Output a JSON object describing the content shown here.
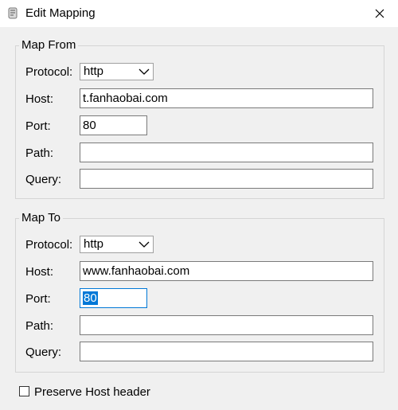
{
  "window": {
    "title": "Edit Mapping",
    "close_label": "×"
  },
  "map_from": {
    "legend": "Map From",
    "protocol_label": "Protocol:",
    "protocol_value": "http",
    "host_label": "Host:",
    "host_value": "t.fanhaobai.com",
    "port_label": "Port:",
    "port_value": "80",
    "path_label": "Path:",
    "path_value": "",
    "query_label": "Query:",
    "query_value": ""
  },
  "map_to": {
    "legend": "Map To",
    "protocol_label": "Protocol:",
    "protocol_value": "http",
    "host_label": "Host:",
    "host_value": "www.fanhaobai.com",
    "port_label": "Port:",
    "port_value": "80",
    "path_label": "Path:",
    "path_value": "",
    "query_label": "Query:",
    "query_value": ""
  },
  "options": {
    "preserve_host_label": "Preserve Host header",
    "preserve_host_checked": false
  },
  "icons": {
    "app": "app-icon",
    "close": "close-icon",
    "dropdown": "chevron-down-icon"
  },
  "colors": {
    "selection": "#0078d7",
    "background": "#f0f0f0",
    "titlebar": "#ffffff"
  }
}
